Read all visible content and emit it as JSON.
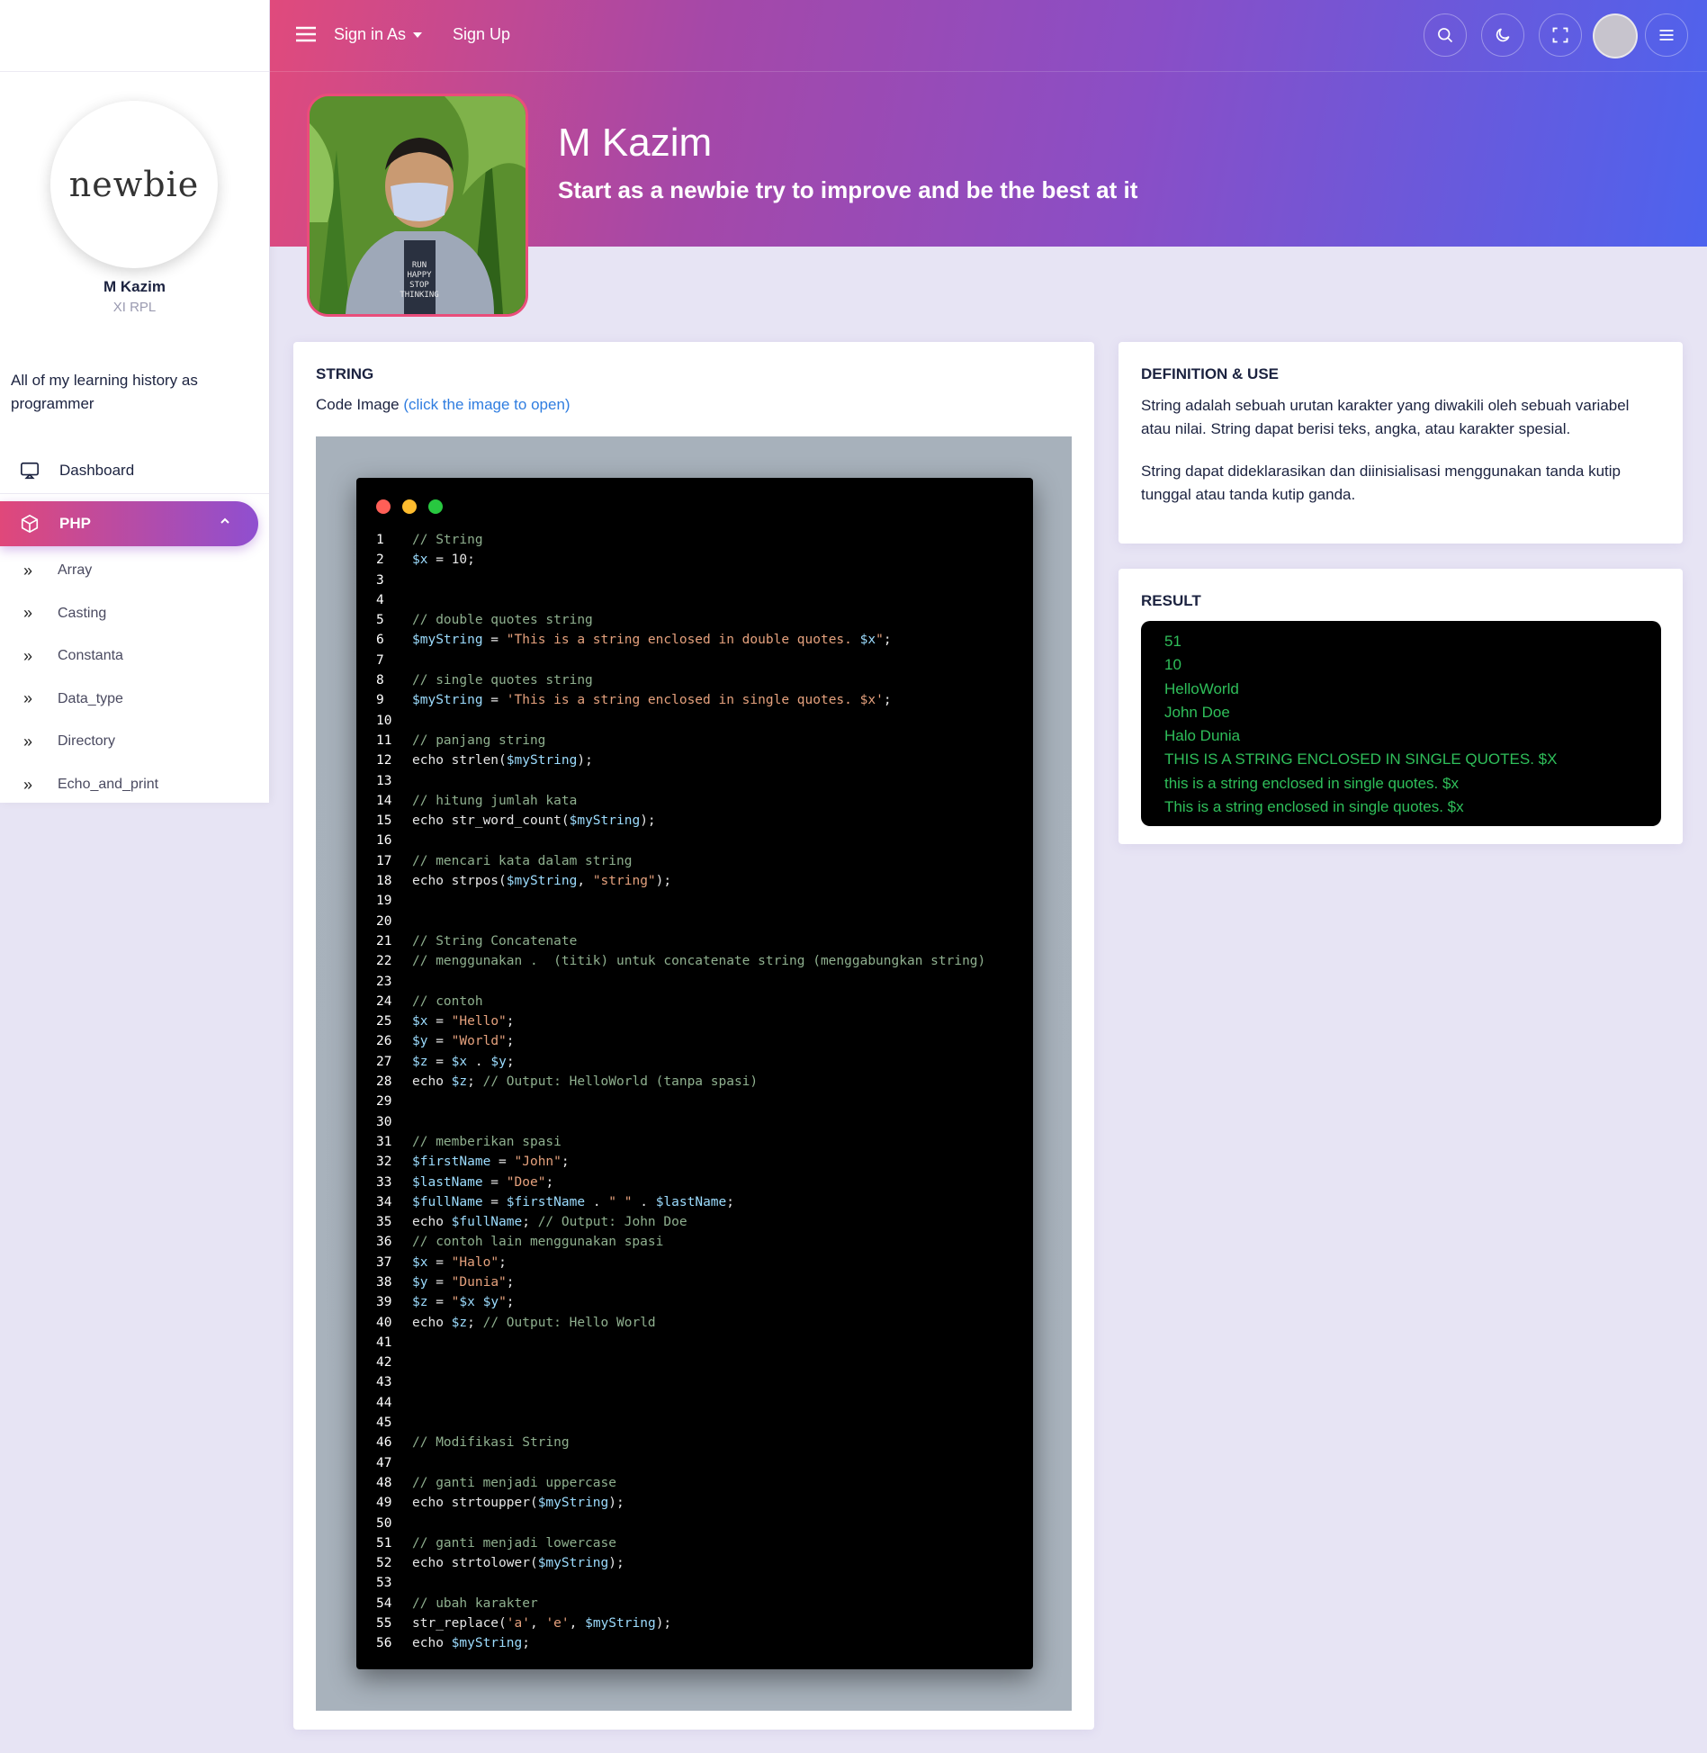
{
  "sidebar": {
    "logo_text": "newbie",
    "user_name": "M Kazim",
    "user_class": "XI RPL",
    "description": "All of my learning history as programmer",
    "nav": {
      "dashboard": "Dashboard",
      "php": "PHP"
    },
    "sub_items": [
      "Array",
      "Casting",
      "Constanta",
      "Data_type",
      "Directory",
      "Echo_and_print"
    ]
  },
  "topbar": {
    "sign_in_as": "Sign in As",
    "sign_up": "Sign Up"
  },
  "profile": {
    "name": "M Kazim",
    "tagline": "Start as a newbie try to improve and be the best at it",
    "shirt_text": "RUN HAPPY STOP THINKING"
  },
  "string_card": {
    "title": "STRING",
    "code_label": "Code Image",
    "code_link": "(click the image to open)"
  },
  "code": {
    "lines": [
      [
        [
          "c",
          "// String"
        ]
      ],
      [
        [
          "v",
          "$x"
        ],
        [
          "p",
          " = 10;"
        ]
      ],
      [],
      [],
      [
        [
          "c",
          "// double quotes string"
        ]
      ],
      [
        [
          "v",
          "$myString"
        ],
        [
          "p",
          " = "
        ],
        [
          "s",
          "\"This is a string enclosed in double quotes. "
        ],
        [
          "v",
          "$x"
        ],
        [
          "s",
          "\""
        ],
        [
          "p",
          ";"
        ]
      ],
      [],
      [
        [
          "c",
          "// single quotes string"
        ]
      ],
      [
        [
          "v",
          "$myString"
        ],
        [
          "p",
          " = "
        ],
        [
          "s",
          "'This is a string enclosed in single quotes. $x'"
        ],
        [
          "p",
          ";"
        ]
      ],
      [],
      [
        [
          "c",
          "// panjang string"
        ]
      ],
      [
        [
          "p",
          "echo strlen("
        ],
        [
          "v",
          "$myString"
        ],
        [
          "p",
          ");"
        ]
      ],
      [],
      [
        [
          "c",
          "// hitung jumlah kata"
        ]
      ],
      [
        [
          "p",
          "echo str_word_count("
        ],
        [
          "v",
          "$myString"
        ],
        [
          "p",
          ");"
        ]
      ],
      [],
      [
        [
          "c",
          "// mencari kata dalam string"
        ]
      ],
      [
        [
          "p",
          "echo strpos("
        ],
        [
          "v",
          "$myString"
        ],
        [
          "p",
          ", "
        ],
        [
          "s",
          "\"string\""
        ],
        [
          "p",
          ");"
        ]
      ],
      [],
      [],
      [
        [
          "c",
          "// String Concatenate"
        ]
      ],
      [
        [
          "c",
          "// menggunakan .  (titik) untuk concatenate string (menggabungkan string)"
        ]
      ],
      [],
      [
        [
          "c",
          "// contoh"
        ]
      ],
      [
        [
          "v",
          "$x"
        ],
        [
          "p",
          " = "
        ],
        [
          "s",
          "\"Hello\""
        ],
        [
          "p",
          ";"
        ]
      ],
      [
        [
          "v",
          "$y"
        ],
        [
          "p",
          " = "
        ],
        [
          "s",
          "\"World\""
        ],
        [
          "p",
          ";"
        ]
      ],
      [
        [
          "v",
          "$z"
        ],
        [
          "p",
          " = "
        ],
        [
          "v",
          "$x"
        ],
        [
          "p",
          " . "
        ],
        [
          "v",
          "$y"
        ],
        [
          "p",
          ";"
        ]
      ],
      [
        [
          "p",
          "echo "
        ],
        [
          "v",
          "$z"
        ],
        [
          "p",
          "; "
        ],
        [
          "c",
          "// Output: HelloWorld (tanpa spasi)"
        ]
      ],
      [],
      [],
      [
        [
          "c",
          "// memberikan spasi"
        ]
      ],
      [
        [
          "v",
          "$firstName"
        ],
        [
          "p",
          " = "
        ],
        [
          "s",
          "\"John\""
        ],
        [
          "p",
          ";"
        ]
      ],
      [
        [
          "v",
          "$lastName"
        ],
        [
          "p",
          " = "
        ],
        [
          "s",
          "\"Doe\""
        ],
        [
          "p",
          ";"
        ]
      ],
      [
        [
          "v",
          "$fullName"
        ],
        [
          "p",
          " = "
        ],
        [
          "v",
          "$firstName"
        ],
        [
          "p",
          " . "
        ],
        [
          "s",
          "\" \""
        ],
        [
          "p",
          " . "
        ],
        [
          "v",
          "$lastName"
        ],
        [
          "p",
          ";"
        ]
      ],
      [
        [
          "p",
          "echo "
        ],
        [
          "v",
          "$fullName"
        ],
        [
          "p",
          "; "
        ],
        [
          "c",
          "// Output: John Doe"
        ]
      ],
      [
        [
          "c",
          "// contoh lain menggunakan spasi"
        ]
      ],
      [
        [
          "v",
          "$x"
        ],
        [
          "p",
          " = "
        ],
        [
          "s",
          "\"Halo\""
        ],
        [
          "p",
          ";"
        ]
      ],
      [
        [
          "v",
          "$y"
        ],
        [
          "p",
          " = "
        ],
        [
          "s",
          "\"Dunia\""
        ],
        [
          "p",
          ";"
        ]
      ],
      [
        [
          "v",
          "$z"
        ],
        [
          "p",
          " = "
        ],
        [
          "s",
          "\""
        ],
        [
          "v",
          "$x $y"
        ],
        [
          "s",
          "\""
        ],
        [
          "p",
          ";"
        ]
      ],
      [
        [
          "p",
          "echo "
        ],
        [
          "v",
          "$z"
        ],
        [
          "p",
          "; "
        ],
        [
          "c",
          "// Output: Hello World"
        ]
      ],
      [],
      [],
      [],
      [],
      [],
      [
        [
          "c",
          "// Modifikasi String"
        ]
      ],
      [],
      [
        [
          "c",
          "// ganti menjadi uppercase"
        ]
      ],
      [
        [
          "p",
          "echo strtoupper("
        ],
        [
          "v",
          "$myString"
        ],
        [
          "p",
          ");"
        ]
      ],
      [],
      [
        [
          "c",
          "// ganti menjadi lowercase"
        ]
      ],
      [
        [
          "p",
          "echo strtolower("
        ],
        [
          "v",
          "$myString"
        ],
        [
          "p",
          ");"
        ]
      ],
      [],
      [
        [
          "c",
          "// ubah karakter"
        ]
      ],
      [
        [
          "p",
          "str_replace("
        ],
        [
          "s",
          "'a'"
        ],
        [
          "p",
          ", "
        ],
        [
          "s",
          "'e'"
        ],
        [
          "p",
          ", "
        ],
        [
          "v",
          "$myString"
        ],
        [
          "p",
          ");"
        ]
      ],
      [
        [
          "p",
          "echo "
        ],
        [
          "v",
          "$myString"
        ],
        [
          "p",
          ";"
        ]
      ]
    ]
  },
  "definition": {
    "title": "DEFINITION & USE",
    "p1": "String adalah sebuah urutan karakter yang diwakili oleh sebuah variabel atau nilai. String dapat berisi teks, angka, atau karakter spesial.",
    "p2": "String dapat dideklarasikan dan diinisialisasi menggunakan tanda kutip tunggal atau tanda kutip ganda."
  },
  "result": {
    "title": "RESULT",
    "lines": [
      "51",
      "10",
      "HelloWorld",
      "John Doe",
      "Halo Dunia",
      "THIS IS A STRING ENCLOSED IN SINGLE QUOTES. $X",
      "this is a string enclosed in single quotes. $x",
      "This is a string enclosed in single quotes. $x"
    ]
  },
  "colors": {
    "accent_pink": "#e04a7c",
    "accent_purple": "#8a4ec6",
    "accent_blue": "#4d63ee",
    "result_green": "#2fbf5a",
    "link_blue": "#2f7de0"
  }
}
